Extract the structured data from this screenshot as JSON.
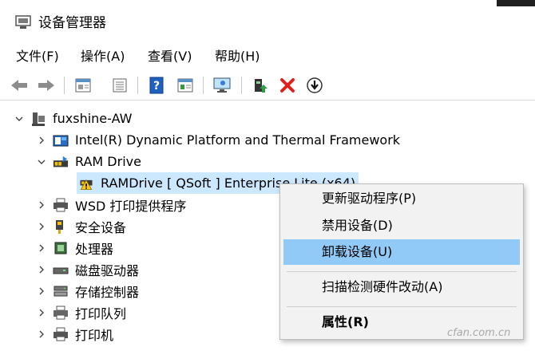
{
  "window": {
    "title": "设备管理器"
  },
  "menu": [
    "文件(F)",
    "操作(A)",
    "查看(V)",
    "帮助(H)"
  ],
  "toolbar": [
    "back-arrow-icon",
    "forward-arrow-icon",
    "properties-icon",
    "view-list-icon",
    "help-icon",
    "view-details-icon",
    "monitor-icon",
    "update-driver-icon",
    "uninstall-icon",
    "download-icon"
  ],
  "tree": {
    "root": "fuxshine-AW",
    "items": [
      {
        "label": "Intel(R) Dynamic Platform and Thermal Framework",
        "icon": "thermal-icon"
      },
      {
        "label": "RAM Drive",
        "icon": "ram-drive-icon"
      },
      {
        "label": "RAMDrive [ QSoft ] Enterprise Lite (x64)",
        "icon": "warning-device-icon"
      },
      {
        "label": "WSD 打印提供程序",
        "icon": "printer-icon"
      },
      {
        "label": "安全设备",
        "icon": "security-key-icon"
      },
      {
        "label": "处理器",
        "icon": "processor-icon"
      },
      {
        "label": "磁盘驱动器",
        "icon": "disk-drive-icon"
      },
      {
        "label": "存储控制器",
        "icon": "storage-controller-icon"
      },
      {
        "label": "打印队列",
        "icon": "print-queue-icon"
      },
      {
        "label": "打印机",
        "icon": "printer-icon"
      }
    ]
  },
  "context_menu": {
    "items": [
      "更新驱动程序(P)",
      "禁用设备(D)",
      "卸载设备(U)",
      "扫描检测硬件改动(A)",
      "属性(R)"
    ]
  },
  "watermark": "cfan.com.cn",
  "colors": {
    "selection": "#cce8ff",
    "menu_hover": "#91c9f7",
    "uninstall_red": "#e0201b"
  }
}
